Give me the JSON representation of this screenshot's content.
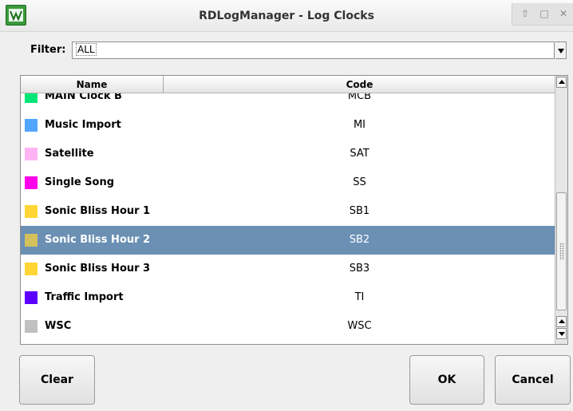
{
  "window": {
    "title": "RDLogManager - Log Clocks",
    "app_icon": "rd-logmanager-icon",
    "controls": [
      "up-arrow-icon",
      "maximize-icon",
      "close-icon"
    ]
  },
  "filter": {
    "label": "Filter:",
    "value": "ALL"
  },
  "list": {
    "columns": [
      "Name",
      "Code"
    ],
    "rows": [
      {
        "name": "MAIN Clock B",
        "code": "MCB",
        "color": "#00e676"
      },
      {
        "name": "Music Import",
        "code": "MI",
        "color": "#52a6ff"
      },
      {
        "name": "Satellite",
        "code": "SAT",
        "color": "#ffb3f3"
      },
      {
        "name": "Single Song",
        "code": "SS",
        "color": "#ff00ea"
      },
      {
        "name": "Sonic Bliss Hour 1",
        "code": "SB1",
        "color": "#ffd633"
      },
      {
        "name": "Sonic Bliss Hour 2",
        "code": "SB2",
        "color": "#d4c15c"
      },
      {
        "name": "Sonic Bliss Hour 3",
        "code": "SB3",
        "color": "#ffd633"
      },
      {
        "name": "Traffic Import",
        "code": "TI",
        "color": "#5c00ff"
      },
      {
        "name": "WSC",
        "code": "WSC",
        "color": "#c0c0c0"
      }
    ],
    "selected": "Sonic Bliss Hour 2"
  },
  "buttons": {
    "clear": "Clear",
    "ok": "OK",
    "cancel": "Cancel"
  },
  "colors": {
    "selection": "#6b90b4"
  }
}
